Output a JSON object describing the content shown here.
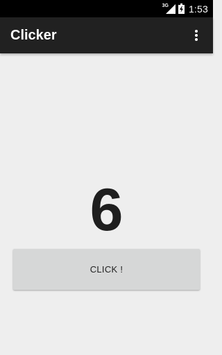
{
  "status_bar": {
    "network_type": "3G",
    "time": "1:53",
    "icons": [
      "signal-icon",
      "battery-charging-icon"
    ]
  },
  "app_bar": {
    "title": "Clicker",
    "overflow_icon": "more-vertical-icon"
  },
  "main": {
    "count": "6",
    "button_label": "CLICK !"
  },
  "colors": {
    "status_bar": "#000000",
    "app_bar": "#212121",
    "background": "#eeeeee",
    "button": "#d6d7d7",
    "counter_text": "#1e1e1e"
  }
}
